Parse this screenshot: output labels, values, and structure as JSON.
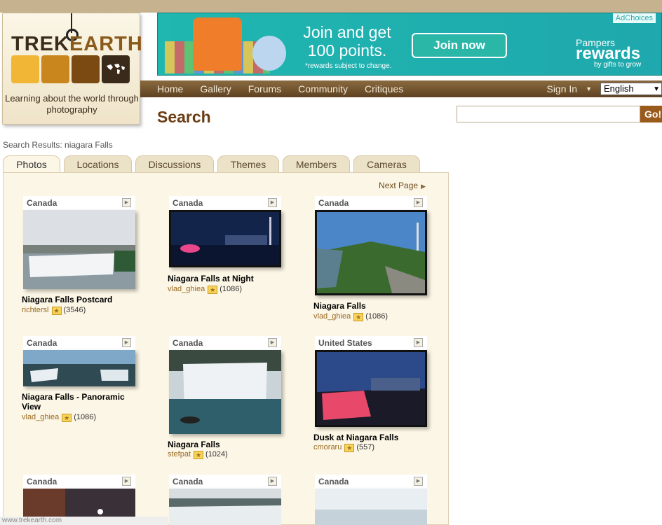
{
  "logo": {
    "word1": "TREK",
    "word2": "EARTH",
    "tagline": "Learning about the world through photography"
  },
  "ad": {
    "choices": "AdChoices",
    "headline": "Join and get 100 points.",
    "note": "*rewards subject to change.",
    "button": "Join now",
    "brand": "Pampers",
    "rewards": "rewards",
    "gifts": "by gifts to grow"
  },
  "nav": {
    "items": [
      "Home",
      "Gallery",
      "Forums",
      "Community",
      "Critiques"
    ],
    "sign_in": "Sign In",
    "language": "English"
  },
  "page": {
    "title": "Search",
    "go": "Go!",
    "results_label": "Search Results: niagara Falls",
    "next_page": "Next Page"
  },
  "tabs": [
    "Photos",
    "Locations",
    "Discussions",
    "Themes",
    "Members",
    "Cameras"
  ],
  "photos": [
    {
      "country": "Canada",
      "title": "Niagara Falls Postcard",
      "user": "richtersl",
      "count": "(3546)"
    },
    {
      "country": "Canada",
      "title": "Niagara Falls at Night",
      "user": "vlad_ghiea",
      "count": "(1086)"
    },
    {
      "country": "Canada",
      "title": "Niagara Falls",
      "user": "vlad_ghiea",
      "count": "(1086)"
    },
    {
      "country": "Canada",
      "title": "Niagara Falls - Panoramic View",
      "user": "vlad_ghiea",
      "count": "(1086)"
    },
    {
      "country": "Canada",
      "title": "Niagara Falls",
      "user": "stefpat",
      "count": "(1024)"
    },
    {
      "country": "United States",
      "title": "Dusk at Niagara Falls",
      "user": "cmoraru",
      "count": "(557)"
    },
    {
      "country": "Canada"
    },
    {
      "country": "Canada"
    },
    {
      "country": "Canada"
    }
  ],
  "status": "www.trekearth.com"
}
